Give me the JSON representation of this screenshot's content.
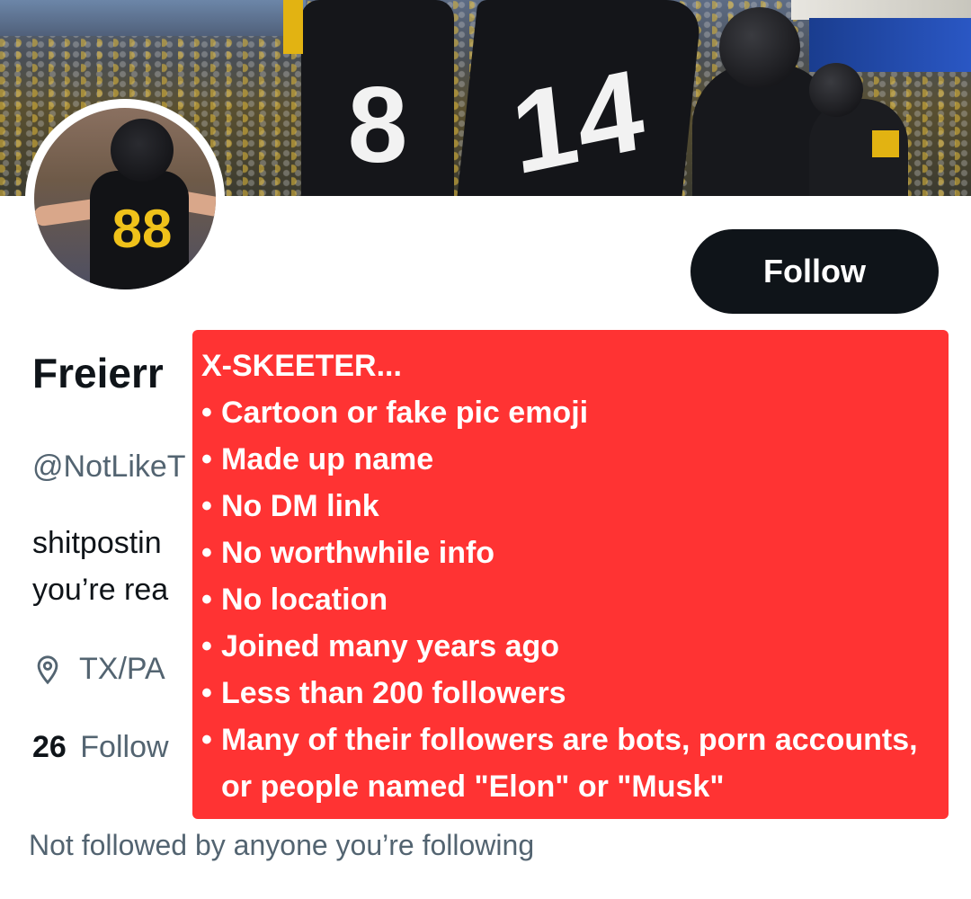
{
  "profile": {
    "display_name": "Freierr",
    "handle": "@NotLikeT",
    "bio_line_1": "shitpostin",
    "bio_line_2": "you’re rea",
    "location": "TX/PA",
    "following_count": "26",
    "following_label": "Follow",
    "not_followed_text": "Not followed by anyone you’re following"
  },
  "follow_button": {
    "label": "Follow"
  },
  "overlay": {
    "title": "X-SKEETER...",
    "items": [
      "Cartoon or fake pic emoji",
      "Made up name",
      "No DM link",
      "No worthwhile info",
      "No location",
      "Joined many years ago",
      "Less than 200 followers",
      "Many of their followers are bots, porn accounts, or people named \"Elon\" or \"Musk\""
    ]
  },
  "banner": {
    "jersey_numbers": [
      "8",
      "14"
    ]
  },
  "avatar": {
    "jersey_number": "88"
  },
  "colors": {
    "overlay_red": "#ff3333",
    "button_black": "#0f1419",
    "muted_gray": "#536471"
  }
}
